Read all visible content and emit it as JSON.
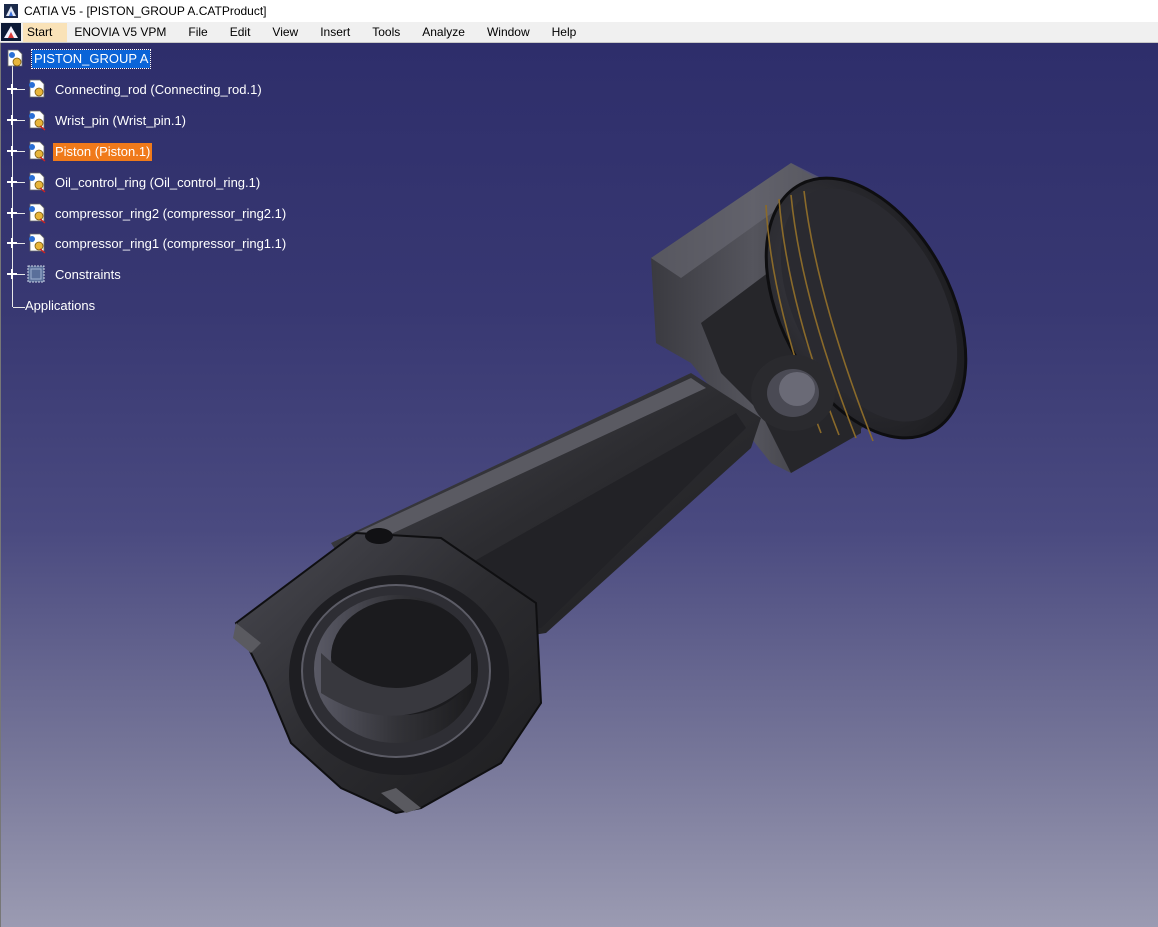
{
  "window": {
    "title": "CATIA V5 - [PISTON_GROUP A.CATProduct]"
  },
  "menubar": {
    "items": [
      {
        "id": "start",
        "label": "Start"
      },
      {
        "id": "enovia",
        "label": "ENOVIA V5 VPM"
      },
      {
        "id": "file",
        "label": "File"
      },
      {
        "id": "edit",
        "label": "Edit"
      },
      {
        "id": "view",
        "label": "View"
      },
      {
        "id": "insert",
        "label": "Insert"
      },
      {
        "id": "tools",
        "label": "Tools"
      },
      {
        "id": "analyze",
        "label": "Analyze"
      },
      {
        "id": "window",
        "label": "Window"
      },
      {
        "id": "help",
        "label": "Help"
      }
    ]
  },
  "tree": {
    "root": {
      "label": "PISTON_GROUP A",
      "icon": "product-icon"
    },
    "children": [
      {
        "label": "Connecting_rod (Connecting_rod.1)",
        "icon": "part-icon",
        "state": "normal"
      },
      {
        "label": "Wrist_pin (Wrist_pin.1)",
        "icon": "part-icon",
        "state": "normal"
      },
      {
        "label": "Piston (Piston.1)",
        "icon": "part-icon",
        "state": "selected"
      },
      {
        "label": "Oil_control_ring (Oil_control_ring.1)",
        "icon": "part-icon",
        "state": "normal"
      },
      {
        "label": "compressor_ring2 (compressor_ring2.1)",
        "icon": "part-icon",
        "state": "normal"
      },
      {
        "label": "compressor_ring1 (compressor_ring1.1)",
        "icon": "part-icon",
        "state": "normal"
      },
      {
        "label": "Constraints",
        "icon": "constraints-icon",
        "state": "normal"
      },
      {
        "label": "Applications",
        "icon": "none",
        "state": "normal"
      }
    ]
  },
  "colors": {
    "selection_orange": "#f07a1a",
    "root_highlight": "#0a64d8",
    "background_top": "#2e2e6b",
    "background_bottom": "#9b9bb2",
    "model_dark": "#2b2b2b",
    "ring_copper": "#8a6a2a"
  }
}
